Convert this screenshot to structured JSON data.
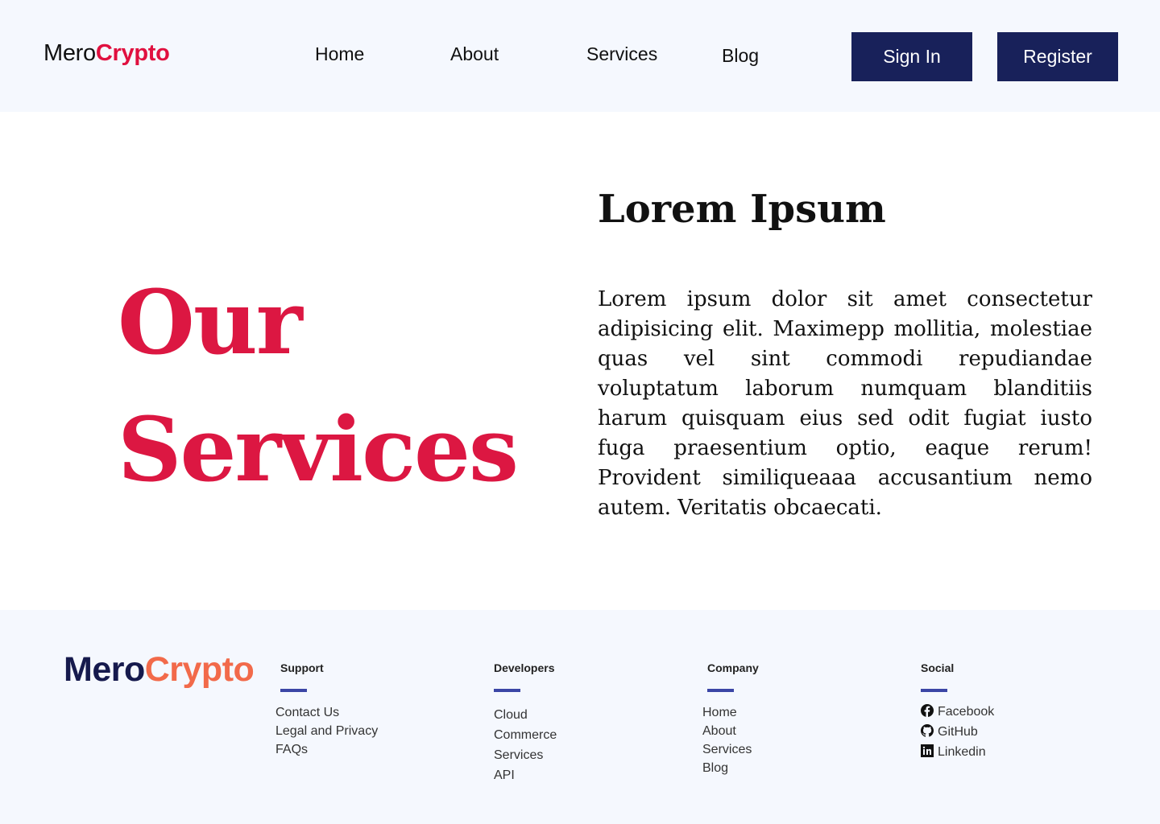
{
  "header": {
    "logo_part1": "Mero",
    "logo_part2": "Crypto",
    "nav": [
      {
        "label": "Home"
      },
      {
        "label": "About"
      },
      {
        "label": "Services"
      },
      {
        "label": "Blog"
      }
    ],
    "signin_label": "Sign In",
    "register_label": "Register"
  },
  "hero": {
    "title_line1": "Our",
    "title_line2": "Services",
    "heading": "Lorem Ipsum",
    "body": "Lorem ipsum dolor sit amet consectetur adipisicing elit. Maximepp mollitia, molestiae quas vel sint commodi repudiandae voluptatum laborum numquam blanditiis harum quisquam eius sed odit fugiat iusto fuga praesentium optio, eaque rerum! Provident similiqueaaa accusantium nemo autem. Veritatis obcaecati."
  },
  "footer": {
    "logo_part1": "Mero",
    "logo_part2": "Crypto",
    "columns": [
      {
        "heading": "Support",
        "items": [
          "Contact Us",
          "Legal and Privacy",
          "FAQs"
        ]
      },
      {
        "heading": "Developers",
        "items": [
          "Cloud",
          "Commerce",
          "Services",
          "API"
        ]
      },
      {
        "heading": "Company",
        "items": [
          "Home",
          "About",
          "Services",
          "Blog"
        ]
      },
      {
        "heading": "Social",
        "items": [
          "Facebook",
          "GitHub",
          "Linkedin"
        ],
        "icons": [
          "facebook-icon",
          "github-icon",
          "linkedin-icon"
        ]
      }
    ]
  },
  "colors": {
    "accent": "#dc1742",
    "button": "#18215a",
    "footer_logo_dark": "#161a4d",
    "footer_logo_orange": "#f26a4a",
    "bar": "#3b46a6",
    "bg_light": "#f5f8fe"
  }
}
